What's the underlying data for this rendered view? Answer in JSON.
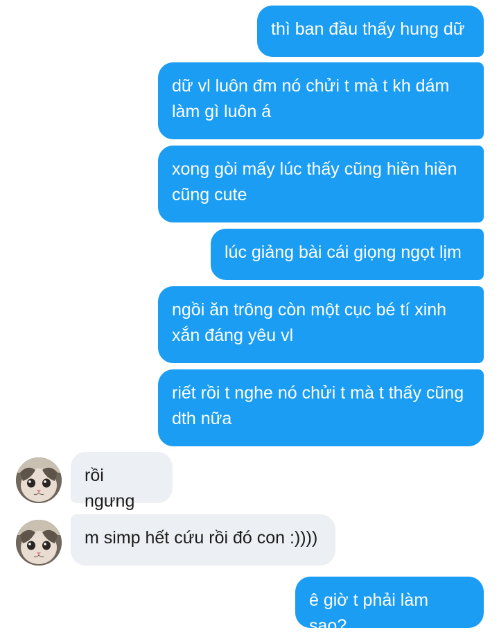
{
  "messages": [
    {
      "from": "me",
      "text": "thì ban đầu thấy hung dữ"
    },
    {
      "from": "me",
      "text": "dữ vl luôn đm nó chửi t mà t kh dám làm gì luôn á"
    },
    {
      "from": "me",
      "text": "xong gòi mấy lúc thấy cũng hiền hiền cũng cute"
    },
    {
      "from": "me",
      "text": "lúc giảng bài cái giọng ngọt lịm"
    },
    {
      "from": "me",
      "text": "ngồi ăn trông còn một cục bé tí xinh xắn đáng yêu vl"
    },
    {
      "from": "me",
      "text": "riết rồi t nghe nó chửi t mà t thấy cũng dth nữa"
    },
    {
      "from": "them",
      "text": "rồi ngưng"
    },
    {
      "from": "them",
      "text": "m simp hết cứu rồi đó con :))))"
    },
    {
      "from": "me",
      "text": "ê giờ t phải làm sao?"
    }
  ],
  "colors": {
    "sent_bubble": "#1a9df2",
    "received_bubble": "#eceff3"
  },
  "avatar": {
    "icon": "cat-avatar-icon"
  }
}
